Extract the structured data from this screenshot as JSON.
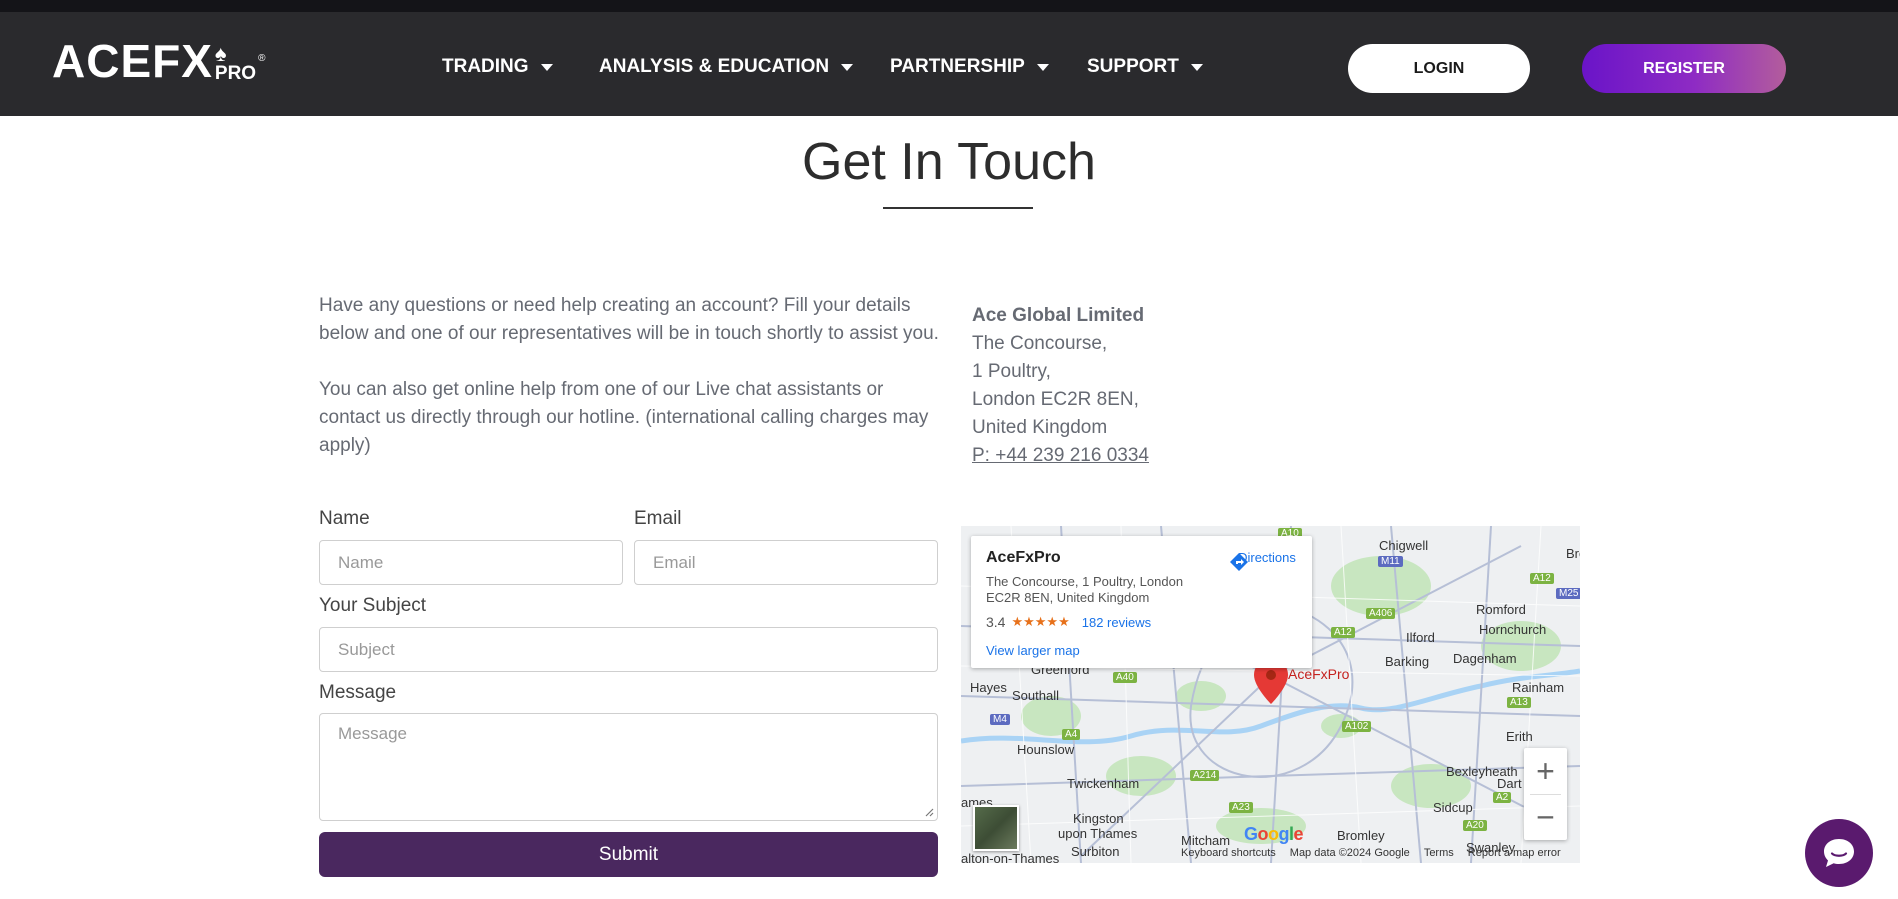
{
  "header": {
    "logo_text": "ACEFX",
    "logo_pro": "PRO",
    "logo_reg": "®",
    "nav": [
      {
        "label": "TRADING"
      },
      {
        "label": "ANALYSIS & EDUCATION"
      },
      {
        "label": "PARTNERSHIP"
      },
      {
        "label": "SUPPORT"
      }
    ],
    "login_label": "LOGIN",
    "register_label": "REGISTER"
  },
  "page": {
    "title": "Get In Touch",
    "intro_1": "Have any questions or need help creating an account? Fill your details below and one of our representatives will be in touch shortly to assist you.",
    "intro_2": "You can also get online help from one of our Live chat assistants or contact us directly through our hotline. (international calling charges may apply)"
  },
  "form": {
    "name_label": "Name",
    "name_placeholder": "Name",
    "email_label": "Email",
    "email_placeholder": "Email",
    "subject_label": "Your Subject",
    "subject_placeholder": "Subject",
    "message_label": "Message",
    "message_placeholder": "Message",
    "submit_label": "Submit"
  },
  "contact": {
    "company": "Ace Global Limited",
    "line1": "The Concourse,",
    "line2": "1 Poultry,",
    "line3": "London EC2R 8EN,",
    "line4": "United Kingdom",
    "phone": "P: +44 239 216 0334"
  },
  "map": {
    "place_name": "AceFxPro",
    "place_address": "The Concourse, 1 Poultry, London EC2R 8EN, United Kingdom",
    "rating": "3.4",
    "stars": "★★★★★",
    "reviews": "182 reviews",
    "larger_map": "View larger map",
    "directions": "Directions",
    "pin_label": "AceFxPro",
    "zoom_in": "+",
    "zoom_out": "−",
    "google": "Google",
    "keyboard": "Keyboard shortcuts",
    "map_data": "Map data ©2024 Google",
    "terms": "Terms",
    "report": "Report a map error",
    "places": {
      "chigwell": "Chigwell",
      "romford": "Romford",
      "hornchurch": "Hornchurch",
      "ilford": "Ilford",
      "barking": "Barking",
      "dagenham": "Dagenham",
      "greenford": "Greenford",
      "hayes": "Hayes",
      "southall": "Southall",
      "rainham": "Rainham",
      "erith": "Erith",
      "hounslow": "Hounslow",
      "twickenham": "Twickenham",
      "bexleyheath": "Bexleyheath",
      "dart": "Dart",
      "sidcup": "Sidcup",
      "kingston": "Kingston",
      "upon_thames": "upon Thames",
      "mitcham": "Mitcham",
      "bromley": "Bromley",
      "surbiton": "Surbiton",
      "walton": "alton-on-Thames",
      "swanley": "Swanley",
      "ames": "ames",
      "bre": "Bre"
    },
    "roads": {
      "m11": "M11",
      "m25": "M25",
      "a12a": "A12",
      "a12b": "A12",
      "a406": "A406",
      "a40": "A40",
      "m4": "M4",
      "a4": "A4",
      "a102": "A102",
      "a13": "A13",
      "a214": "A214",
      "a23": "A23",
      "a2": "A2",
      "a20": "A20",
      "a10": "A10"
    }
  }
}
